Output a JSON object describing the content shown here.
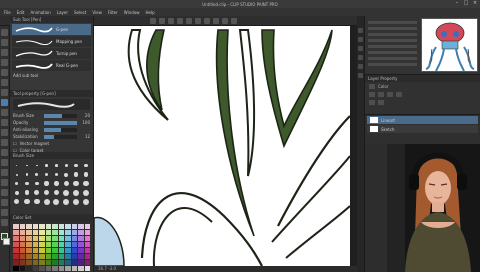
{
  "window": {
    "title": "Untitled.clip - CLIP STUDIO PAINT PRO"
  },
  "menu": [
    "File",
    "Edit",
    "Animation",
    "Layer",
    "Select",
    "View",
    "Filter",
    "Window",
    "Help"
  ],
  "subtool_panel": {
    "title": "Sub Tool [Pen]",
    "brushes": [
      {
        "name": "G-pen"
      },
      {
        "name": "Mapping pen"
      },
      {
        "name": "Turnip pen"
      },
      {
        "name": "Real G-pen"
      }
    ],
    "footer": "Add sub tool"
  },
  "tool_property": {
    "title": "Tool property [G-pen]",
    "brush_name": "G-pen",
    "rows": [
      {
        "label": "Brush Size",
        "value": "20",
        "fill": 0.55
      },
      {
        "label": "Opacity",
        "value": "100",
        "fill": 1.0
      },
      {
        "label": "Anti-aliasing",
        "value": "",
        "fill": 0.5
      },
      {
        "label": "Stabilization",
        "value": "12",
        "fill": 0.3
      }
    ],
    "checks": [
      "Vector magnet",
      "Color target"
    ]
  },
  "brush_size_panel": {
    "title": "Brush Size"
  },
  "color_set_panel": {
    "title": "Color Set"
  },
  "canvas": {
    "status": "16.7    -3.0"
  },
  "layer_property": {
    "title": "Layer Property",
    "expression": "Color"
  },
  "layers": {
    "items": [
      {
        "name": "Lineart",
        "selected": true
      },
      {
        "name": "Sketch",
        "selected": false
      }
    ]
  },
  "colors": {
    "main_color": "#2f4a26",
    "sub_color": "#f2f2f2",
    "accent": "#4a6a8a",
    "leaf_fill": "#3e5a2c",
    "skin_blue": "#bcd7ea"
  }
}
